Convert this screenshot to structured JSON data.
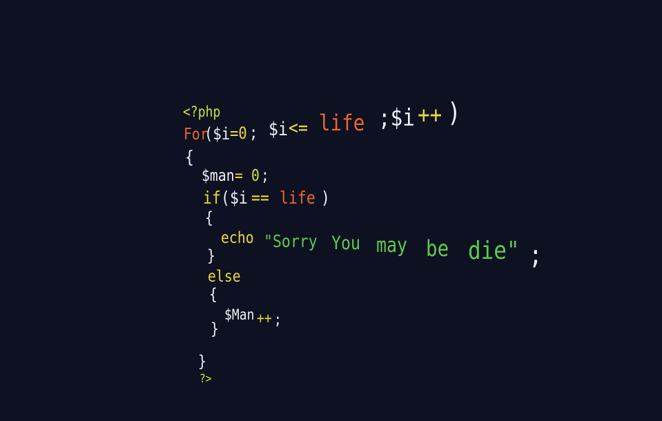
{
  "colors": {
    "background": "#0e1122",
    "plain": "#eef0f4",
    "keyword_orange": "#e8692a",
    "operator_yellow": "#e9d93a",
    "php_tag": "#c9e23e",
    "string_green": "#5fc94d"
  },
  "code": {
    "open_tag": "<?php",
    "for_line": [
      "For",
      "($i",
      "=0",
      ";",
      "$i",
      "<=",
      "life",
      ";$i",
      "++",
      ")"
    ],
    "brace_open_1": "{",
    "man_line": [
      "$man",
      "=",
      "0",
      ";"
    ],
    "if_line": [
      "if",
      "($i",
      "==",
      "life",
      ")"
    ],
    "brace_open_2": "{",
    "echo_line": [
      "echo",
      "\"Sorry",
      "You",
      "may",
      "be",
      "die\"",
      ";"
    ],
    "brace_close_2": "}",
    "else_kw": "else",
    "brace_open_3": "{",
    "man_inc_line": [
      "$Man",
      "++",
      ";"
    ],
    "brace_close_3": "}",
    "brace_close_1": "}",
    "close_tag": "?>"
  }
}
